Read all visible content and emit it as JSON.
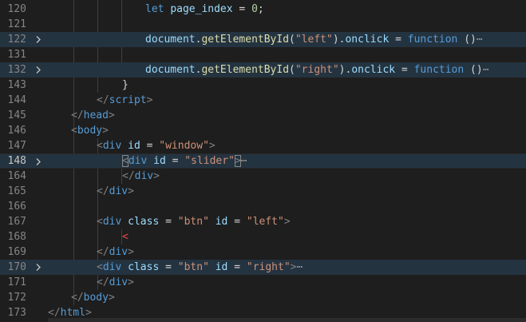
{
  "editor": {
    "language": "html",
    "lines": [
      {
        "number": "120",
        "folded": false,
        "tokens": [
          {
            "t": "let ",
            "c": "kw"
          },
          {
            "t": "page_index",
            "c": "var"
          },
          {
            "t": " = ",
            "c": "op"
          },
          {
            "t": "0",
            "c": "num"
          },
          {
            "t": ";",
            "c": "plain"
          }
        ]
      },
      {
        "number": "121",
        "folded": false,
        "tokens": []
      },
      {
        "number": "122",
        "folded": true,
        "tokens": [
          {
            "t": "document",
            "c": "var"
          },
          {
            "t": ".",
            "c": "plain"
          },
          {
            "t": "getElementById",
            "c": "fn"
          },
          {
            "t": "(",
            "c": "plain"
          },
          {
            "t": "\"left\"",
            "c": "str"
          },
          {
            "t": ").",
            "c": "plain"
          },
          {
            "t": "onclick",
            "c": "var"
          },
          {
            "t": " = ",
            "c": "op"
          },
          {
            "t": "function",
            "c": "kw"
          },
          {
            "t": " ()",
            "c": "plain"
          },
          {
            "t": "⋯",
            "c": "fold"
          }
        ]
      },
      {
        "number": "131",
        "folded": false,
        "tokens": []
      },
      {
        "number": "132",
        "folded": true,
        "tokens": [
          {
            "t": "document",
            "c": "var"
          },
          {
            "t": ".",
            "c": "plain"
          },
          {
            "t": "getElementById",
            "c": "fn"
          },
          {
            "t": "(",
            "c": "plain"
          },
          {
            "t": "\"right\"",
            "c": "str"
          },
          {
            "t": ").",
            "c": "plain"
          },
          {
            "t": "onclick",
            "c": "var"
          },
          {
            "t": " = ",
            "c": "op"
          },
          {
            "t": "function",
            "c": "kw"
          },
          {
            "t": " ()",
            "c": "plain"
          },
          {
            "t": "⋯",
            "c": "fold"
          }
        ]
      },
      {
        "number": "143",
        "folded": false,
        "tokens": [
          {
            "t": "}",
            "c": "plain"
          }
        ]
      },
      {
        "number": "144",
        "folded": false,
        "tokens": [
          {
            "t": "</",
            "c": "tag"
          },
          {
            "t": "script",
            "c": "name"
          },
          {
            "t": ">",
            "c": "tag"
          }
        ]
      },
      {
        "number": "145",
        "folded": false,
        "tokens": [
          {
            "t": "</",
            "c": "tag"
          },
          {
            "t": "head",
            "c": "name"
          },
          {
            "t": ">",
            "c": "tag"
          }
        ]
      },
      {
        "number": "146",
        "folded": false,
        "tokens": [
          {
            "t": "<",
            "c": "tag"
          },
          {
            "t": "body",
            "c": "name"
          },
          {
            "t": ">",
            "c": "tag"
          }
        ]
      },
      {
        "number": "147",
        "folded": false,
        "tokens": [
          {
            "t": "<",
            "c": "tag"
          },
          {
            "t": "div",
            "c": "name"
          },
          {
            "t": " id",
            "c": "attr"
          },
          {
            "t": " = ",
            "c": "op"
          },
          {
            "t": "\"window\"",
            "c": "str"
          },
          {
            "t": ">",
            "c": "tag"
          }
        ]
      },
      {
        "number": "148",
        "folded": true,
        "tokens": [
          {
            "t": "<",
            "c": "tag",
            "match": true
          },
          {
            "t": "div",
            "c": "name"
          },
          {
            "t": " id",
            "c": "attr"
          },
          {
            "t": " = ",
            "c": "op"
          },
          {
            "t": "\"slider\"",
            "c": "str"
          },
          {
            "t": ">",
            "c": "tag",
            "match": true
          },
          {
            "t": "⋯",
            "c": "fold"
          }
        ]
      },
      {
        "number": "164",
        "folded": false,
        "tokens": [
          {
            "t": "</",
            "c": "tag"
          },
          {
            "t": "div",
            "c": "name"
          },
          {
            "t": ">",
            "c": "tag"
          }
        ]
      },
      {
        "number": "165",
        "folded": false,
        "tokens": [
          {
            "t": "</",
            "c": "tag"
          },
          {
            "t": "div",
            "c": "name"
          },
          {
            "t": ">",
            "c": "tag"
          }
        ]
      },
      {
        "number": "166",
        "folded": false,
        "tokens": []
      },
      {
        "number": "167",
        "folded": false,
        "tokens": [
          {
            "t": "<",
            "c": "tag"
          },
          {
            "t": "div",
            "c": "name"
          },
          {
            "t": " class",
            "c": "attr"
          },
          {
            "t": " = ",
            "c": "op"
          },
          {
            "t": "\"btn\"",
            "c": "str"
          },
          {
            "t": " id",
            "c": "attr"
          },
          {
            "t": " = ",
            "c": "op"
          },
          {
            "t": "\"left\"",
            "c": "str"
          },
          {
            "t": ">",
            "c": "tag"
          }
        ]
      },
      {
        "number": "168",
        "folded": false,
        "tokens": [
          {
            "t": "<",
            "c": "err"
          }
        ]
      },
      {
        "number": "169",
        "folded": false,
        "tokens": [
          {
            "t": "</",
            "c": "tag"
          },
          {
            "t": "div",
            "c": "name"
          },
          {
            "t": ">",
            "c": "tag"
          }
        ]
      },
      {
        "number": "170",
        "folded": true,
        "tokens": [
          {
            "t": "<",
            "c": "tag"
          },
          {
            "t": "div",
            "c": "name"
          },
          {
            "t": " class",
            "c": "attr"
          },
          {
            "t": " = ",
            "c": "op"
          },
          {
            "t": "\"btn\"",
            "c": "str"
          },
          {
            "t": " id",
            "c": "attr"
          },
          {
            "t": " = ",
            "c": "op"
          },
          {
            "t": "\"right\"",
            "c": "str"
          },
          {
            "t": ">",
            "c": "tag"
          },
          {
            "t": "⋯",
            "c": "fold"
          }
        ]
      },
      {
        "number": "171",
        "folded": false,
        "tokens": [
          {
            "t": "</",
            "c": "tag"
          },
          {
            "t": "div",
            "c": "name"
          },
          {
            "t": ">",
            "c": "tag"
          }
        ]
      },
      {
        "number": "172",
        "folded": false,
        "tokens": [
          {
            "t": "</",
            "c": "tag"
          },
          {
            "t": "body",
            "c": "name"
          },
          {
            "t": ">",
            "c": "tag"
          }
        ]
      },
      {
        "number": "173",
        "folded": false,
        "tokens": [
          {
            "t": "</",
            "c": "tag"
          },
          {
            "t": "html",
            "c": "name"
          },
          {
            "t": ">",
            "c": "tag"
          }
        ]
      }
    ],
    "fold_icon": "chevron-right-icon",
    "colors": {
      "background": "#1e1e1e",
      "folded_line_background": "#243340",
      "line_number": "#858585",
      "tag_bracket": "#808080",
      "tag_name": "#569cd6",
      "attribute": "#9cdcfe",
      "string": "#ce9178",
      "keyword": "#569cd6",
      "function": "#dcdcaa",
      "number": "#b5cea8",
      "error": "#f44747"
    }
  }
}
